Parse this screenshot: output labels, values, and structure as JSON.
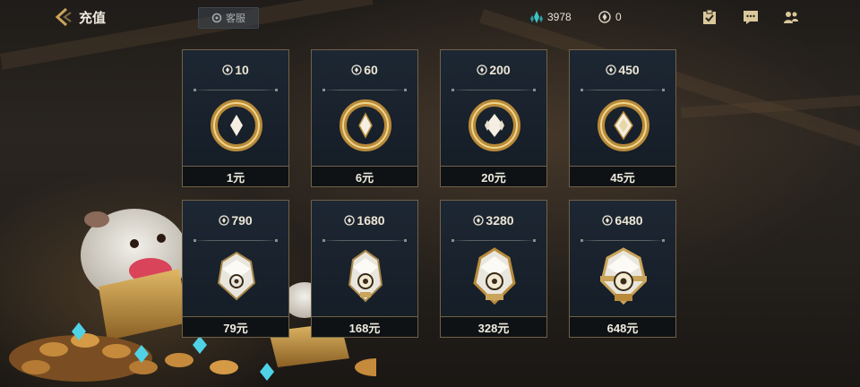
{
  "header": {
    "title": "充值",
    "service_label": "客服",
    "blue_essence": "3978",
    "coins": "0"
  },
  "icons": {
    "back": "chevron-left-icon",
    "service": "headset-icon",
    "blue_essence": "crystal-icon",
    "coin": "coin-icon",
    "quests": "clipboard-icon",
    "chat": "chat-icon",
    "friends": "friends-icon"
  },
  "colors": {
    "accent_gold": "#c9a45a",
    "card_bg": "#18212b",
    "border": "#6f6148",
    "blue": "#3fc3c8"
  },
  "packages": [
    {
      "amount": "10",
      "price": "1元"
    },
    {
      "amount": "60",
      "price": "6元"
    },
    {
      "amount": "200",
      "price": "20元"
    },
    {
      "amount": "450",
      "price": "45元"
    },
    {
      "amount": "790",
      "price": "79元"
    },
    {
      "amount": "1680",
      "price": "168元"
    },
    {
      "amount": "3280",
      "price": "328元"
    },
    {
      "amount": "6480",
      "price": "648元"
    }
  ]
}
